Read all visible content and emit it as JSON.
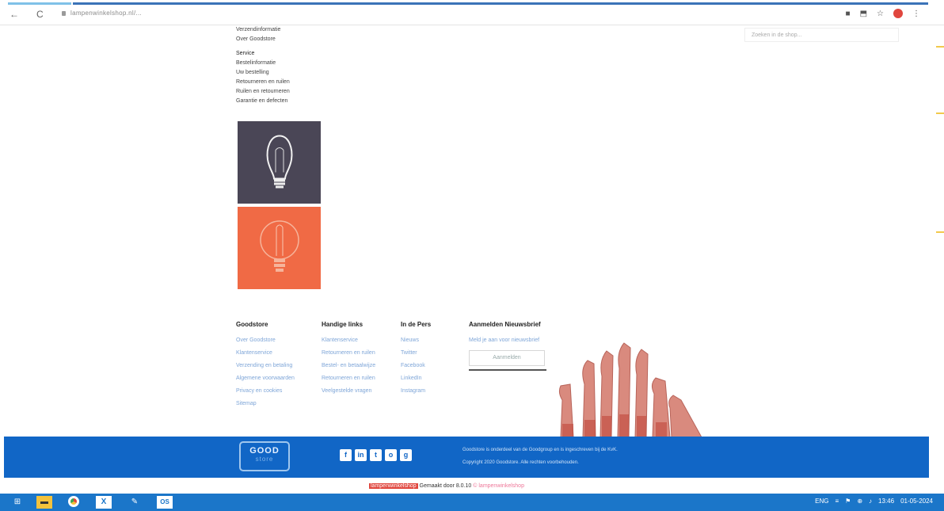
{
  "browser": {
    "url": "lampenwinkelshop.nl/...",
    "back_icon": "←",
    "reload_icon": "C"
  },
  "search_ghost": "Zoeken in de shop...",
  "top_links": {
    "block1": [
      "Verzendinformatie",
      "Over Goodstore"
    ],
    "service_heading": "Service",
    "service": [
      "Bestelinformatie",
      "Uw bestelling",
      "Retourneren en ruilen",
      "Ruilen en retourneren",
      "Garantie en defecten"
    ]
  },
  "footer_columns": {
    "goodstore": {
      "title": "Goodstore",
      "links": [
        "Over Goodstore",
        "Klantenservice",
        "Verzending en betaling",
        "Algemene voorwaarden",
        "Privacy en cookies",
        "Sitemap"
      ]
    },
    "handige": {
      "title": "Handige links",
      "links": [
        "Klantenservice",
        "Retourneren en ruilen",
        "Bestel- en betaalwijze",
        "Retourneren en ruilen",
        "Veelgestelde vragen"
      ]
    },
    "pers": {
      "title": "In de Pers",
      "links": [
        "Nieuws",
        "Twitter",
        "Facebook",
        "LinkedIn",
        "Instagram"
      ]
    },
    "newsletter": {
      "title": "Aanmelden Nieuwsbrief",
      "text": "Meld je aan voor nieuwsbrief",
      "button": "Aanmelden"
    }
  },
  "footer_bar": {
    "logo_text": "GOOD",
    "logo_sub": "store",
    "social": [
      "f",
      "in",
      "t",
      "o",
      "g"
    ],
    "text_line1": "Goodstore is onderdeel van de Goodgroup en is ingeschreven bij de KvK.",
    "text_line2": "Copyright 2020 Goodstore. Alle rechten voorbehouden."
  },
  "status_line": {
    "brand": "lampenwinkelshop",
    "text": "Gemaakt door 8.0.10",
    "ghost": "© lampenwinkelshop"
  },
  "taskbar": {
    "tray": [
      "ENG",
      "≡",
      "⚑",
      "⊕",
      "♪",
      "13:46",
      "01-05-2024"
    ]
  }
}
